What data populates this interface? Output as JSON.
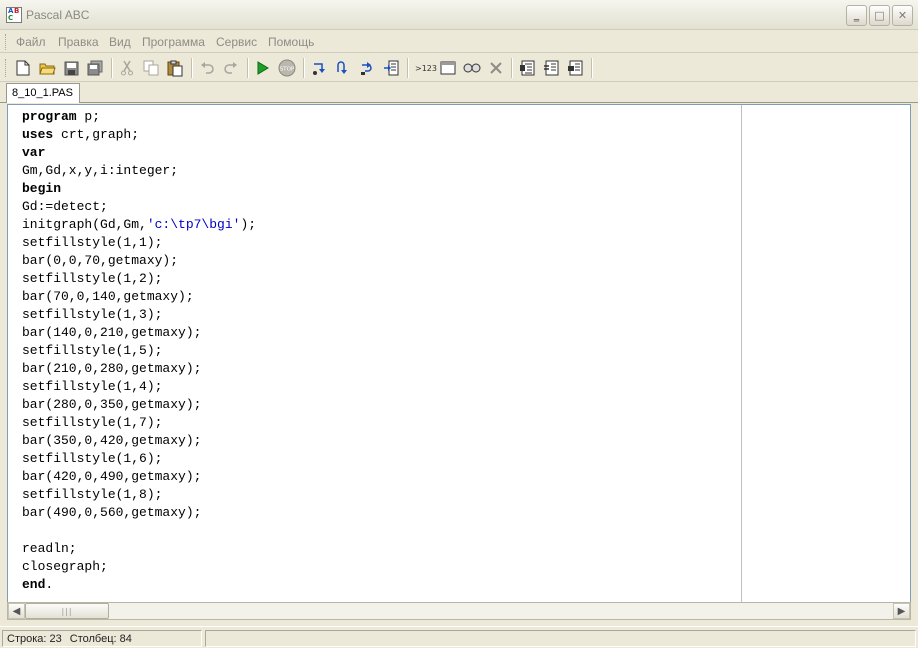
{
  "window": {
    "title": "Pascal ABC",
    "icon_letters": [
      "A",
      "B",
      "C"
    ],
    "controls": {
      "minimize": "‗",
      "maximize": "□",
      "close": "✕"
    }
  },
  "menu": [
    "Файл",
    "Правка",
    "Вид",
    "Программа",
    "Сервис",
    "Помощь"
  ],
  "toolbar": {
    "groups": [
      [
        "new-file-icon",
        "open-folder-icon",
        "save-icon",
        "save-all-icon"
      ],
      [
        "cut-icon",
        "copy-icon",
        "paste-icon"
      ],
      [
        "undo-icon",
        "redo-icon"
      ],
      [
        "run-icon",
        "stop-icon"
      ],
      [
        "step-into-icon",
        "step-over-icon",
        "step-out-icon",
        "run-to-cursor-icon"
      ],
      [
        "evaluate-icon",
        "output-window-icon",
        "watch-icon",
        "clear-icon"
      ],
      [
        "format-code-icon",
        "comment-icon",
        "uncomment-icon"
      ]
    ],
    "evaluate_label": ">123"
  },
  "tabs": [
    {
      "label": "8_10_1.PAS"
    }
  ],
  "editor": {
    "lines": [
      [
        {
          "t": "program",
          "k": "kw"
        },
        {
          "t": " p;"
        }
      ],
      [
        {
          "t": "uses",
          "k": "kw"
        },
        {
          "t": " crt,graph;"
        }
      ],
      [
        {
          "t": "var",
          "k": "kw"
        }
      ],
      [
        {
          "t": "Gm,Gd,x,y,i:integer;"
        }
      ],
      [
        {
          "t": "begin",
          "k": "kw"
        }
      ],
      [
        {
          "t": "Gd:=detect;"
        }
      ],
      [
        {
          "t": "initgraph(Gd,Gm,"
        },
        {
          "t": "'c:\\tp7\\bgi'",
          "k": "str"
        },
        {
          "t": ");"
        }
      ],
      [
        {
          "t": "setfillstyle(1,1);"
        }
      ],
      [
        {
          "t": "bar(0,0,70,getmaxy);"
        }
      ],
      [
        {
          "t": "setfillstyle(1,2);"
        }
      ],
      [
        {
          "t": "bar(70,0,140,getmaxy);"
        }
      ],
      [
        {
          "t": "setfillstyle(1,3);"
        }
      ],
      [
        {
          "t": "bar(140,0,210,getmaxy);"
        }
      ],
      [
        {
          "t": "setfillstyle(1,5);"
        }
      ],
      [
        {
          "t": "bar(210,0,280,getmaxy);"
        }
      ],
      [
        {
          "t": "setfillstyle(1,4);"
        }
      ],
      [
        {
          "t": "bar(280,0,350,getmaxy);"
        }
      ],
      [
        {
          "t": "setfillstyle(1,7);"
        }
      ],
      [
        {
          "t": "bar(350,0,420,getmaxy);"
        }
      ],
      [
        {
          "t": "setfillstyle(1,6);"
        }
      ],
      [
        {
          "t": "bar(420,0,490,getmaxy);"
        }
      ],
      [
        {
          "t": "setfillstyle(1,8);"
        }
      ],
      [
        {
          "t": "bar(490,0,560,getmaxy);"
        }
      ],
      [],
      [
        {
          "t": "readln;"
        }
      ],
      [
        {
          "t": "closegraph;"
        }
      ],
      [
        {
          "t": "end",
          "k": "kw"
        },
        {
          "t": "."
        }
      ]
    ]
  },
  "scrollbar": {
    "left_arrow": "◀",
    "right_arrow": "▶",
    "thumb_grip": "|||"
  },
  "status": {
    "line": "Строка: 23",
    "column": "Столбец: 84"
  },
  "colors": {
    "keyword": "#000000",
    "string": "#0000c8",
    "disabled_menu": "#8e8c85"
  }
}
